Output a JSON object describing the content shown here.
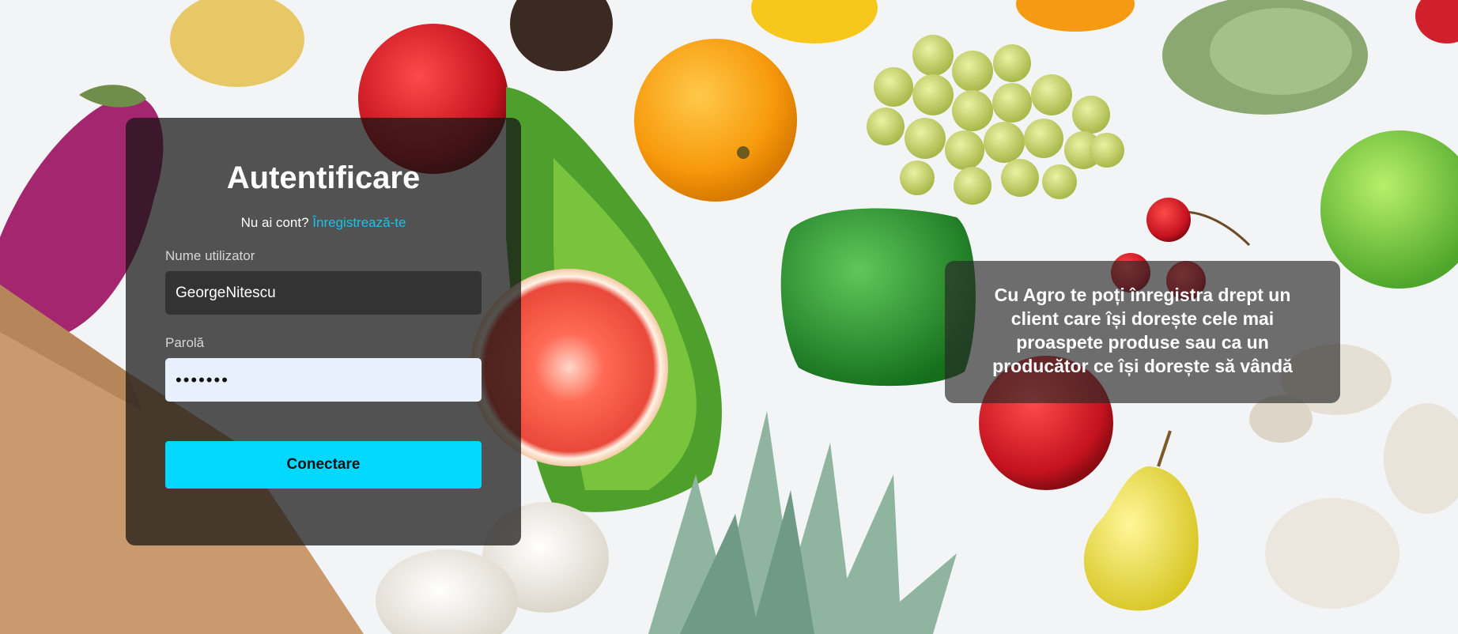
{
  "login": {
    "title": "Autentificare",
    "no_account_text": "Nu ai cont?",
    "register_link": "Înregistrează-te",
    "username_label": "Nume utilizator",
    "username_value": "GeorgeNitescu",
    "password_label": "Parolă",
    "password_value": "•••••••",
    "submit_label": "Conectare"
  },
  "info": {
    "text": "Cu Agro te poți înregistra drept un client care își dorește cele mai proaspete produse sau ca un producător ce își dorește să vândă"
  },
  "colors": {
    "accent": "#00d8ff",
    "link": "#17c3ef",
    "panel_bg": "rgba(20,20,20,0.72)",
    "autofill_bg": "#e8f0fe"
  },
  "background": {
    "image_subject": "fresh-fruits-and-vegetables"
  }
}
